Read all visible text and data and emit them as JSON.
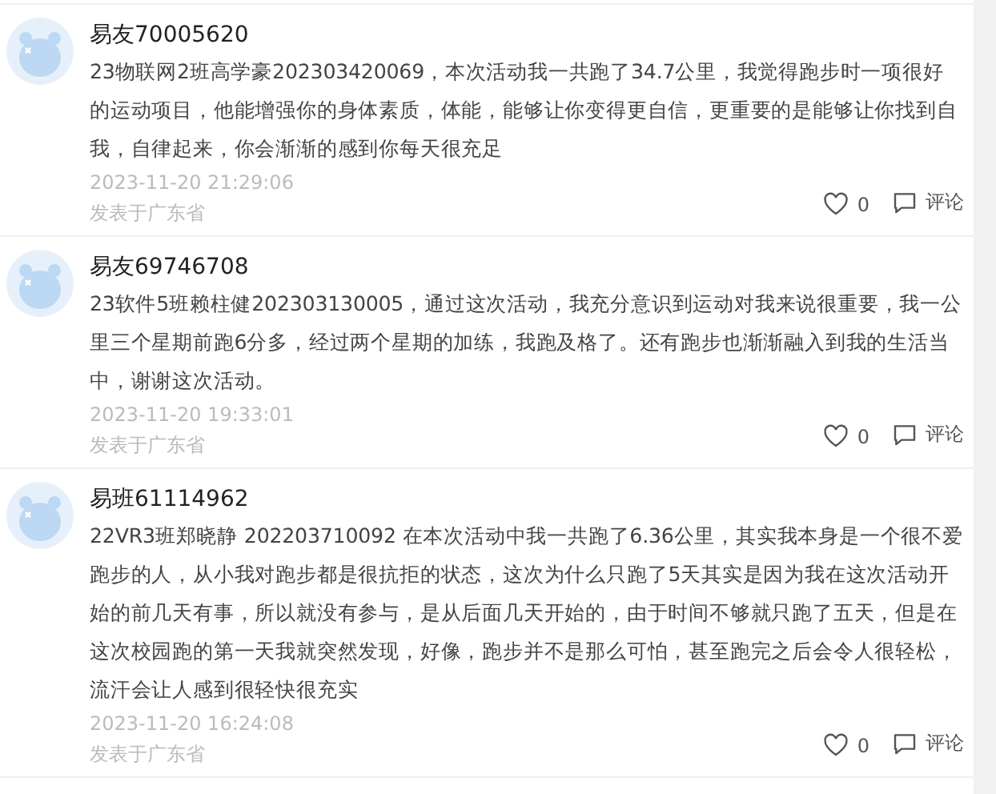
{
  "comments": [
    {
      "user": "易友70005620",
      "body": "23物联网2班高学豪202303420069，本次活动我一共跑了34.7公里，我觉得跑步时一项很好的运动项目，他能增强你的身体素质，体能，能够让你变得更自信，更重要的是能够让你找到自我，自律起来，你会渐渐的感到你每天很充足",
      "time": "2023-11-20 21:29:06",
      "location": "发表于广东省",
      "likes": "0",
      "reply": "评论"
    },
    {
      "user": "易友69746708",
      "body": "23软件5班赖柱健202303130005，通过这次活动，我充分意识到运动对我来说很重要，我一公里三个星期前跑6分多，经过两个星期的加练，我跑及格了。还有跑步也渐渐融入到我的生活当中，谢谢这次活动。",
      "time": "2023-11-20 19:33:01",
      "location": "发表于广东省",
      "likes": "0",
      "reply": "评论"
    },
    {
      "user": "易班61114962",
      "body": "22VR3班郑晓静 202203710092 在本次活动中我一共跑了6.36公里，其实我本身是一个很不爱跑步的人，从小我对跑步都是很抗拒的状态，这次为什么只跑了5天其实是因为我在这次活动开始的前几天有事，所以就没有参与，是从后面几天开始的，由于时间不够就只跑了五天，但是在这次校园跑的第一天我就突然发现，好像，跑步并不是那么可怕，甚至跑完之后会令人很轻松，流汗会让人感到很轻快很充实",
      "time": "2023-11-20 16:24:08",
      "location": "发表于广东省",
      "likes": "0",
      "reply": "评论"
    }
  ]
}
